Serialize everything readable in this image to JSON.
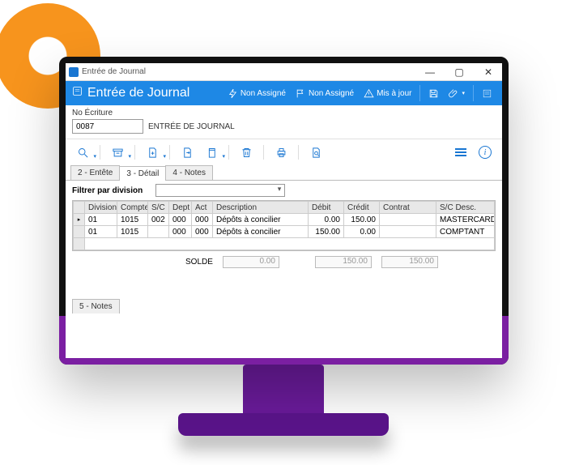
{
  "window": {
    "title": "Entrée de Journal"
  },
  "header": {
    "title": "Entrée de Journal",
    "items": [
      "Non Assigné",
      "Non Assigné",
      "Mis à jour"
    ]
  },
  "entry": {
    "label": "No Écriture",
    "number": "0087",
    "type": "ENTRÉE DE JOURNAL"
  },
  "tabs": [
    "2 - Entête",
    "3 - Détail",
    "4 - Notes"
  ],
  "filter": {
    "label": "Filtrer par division"
  },
  "grid": {
    "columns": [
      "Division",
      "Compte",
      "S/C",
      "Dept",
      "Act",
      "Description",
      "Débit",
      "Crédit",
      "Contrat",
      "S/C Desc."
    ],
    "rows": [
      {
        "division": "01",
        "compte": "1015",
        "sc": "002",
        "dept": "000",
        "act": "000",
        "description": "Dépôts à concilier",
        "debit": "0.00",
        "credit": "150.00",
        "contrat": "",
        "scdesc": "MASTERCARD"
      },
      {
        "division": "01",
        "compte": "1015",
        "sc": "",
        "dept": "000",
        "act": "000",
        "description": "Dépôts à concilier",
        "debit": "150.00",
        "credit": "0.00",
        "contrat": "",
        "scdesc": "COMPTANT"
      }
    ]
  },
  "totals": {
    "label": "SOLDE",
    "solde": "0.00",
    "debit": "150.00",
    "credit": "150.00"
  },
  "bottom_tab": "5 - Notes"
}
